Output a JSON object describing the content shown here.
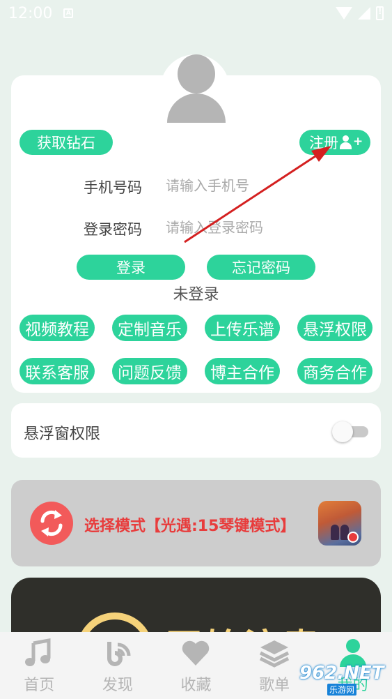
{
  "status_bar": {
    "time": "12:00",
    "notif_letter": "A"
  },
  "profile": {
    "diamond_button": "获取钻石",
    "register_button": "注册",
    "phone_label": "手机号码",
    "phone_placeholder": "请输入手机号",
    "password_label": "登录密码",
    "password_placeholder": "请输入登录密码",
    "login_button": "登录",
    "forgot_button": "忘记密码",
    "login_status": "未登录"
  },
  "feature_buttons": [
    "视频教程",
    "定制音乐",
    "上传乐谱",
    "悬浮权限",
    "联系客服",
    "问题反馈",
    "博主合作",
    "商务合作"
  ],
  "float_permission": {
    "label": "悬浮窗权限",
    "enabled": false
  },
  "mode": {
    "text": "选择模式【光遇:15琴键模式】"
  },
  "dark_card": {
    "text": "开始演奏"
  },
  "bottom_nav": [
    {
      "label": "首页",
      "icon": "music-note-icon",
      "active": false
    },
    {
      "label": "发现",
      "icon": "discover-icon",
      "active": false
    },
    {
      "label": "收藏",
      "icon": "heart-icon",
      "active": false
    },
    {
      "label": "歌单",
      "icon": "layers-icon",
      "active": false
    },
    {
      "label": "我的",
      "icon": "user-icon",
      "active": true
    }
  ],
  "watermark": {
    "number": "962.NET",
    "sub": "乐游网"
  },
  "colors": {
    "accent": "#2dd39b",
    "mode_text": "#e83c3c",
    "background": "#e9f2ed"
  }
}
